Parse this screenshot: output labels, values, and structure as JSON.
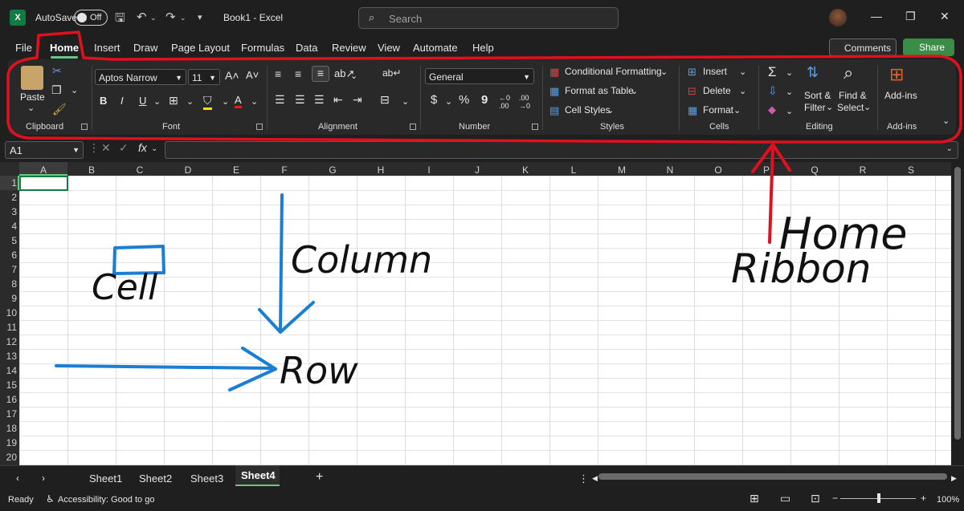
{
  "titlebar": {
    "autosave_label": "AutoSave",
    "autosave_state": "Off",
    "doc_title": "Book1  -  Excel",
    "search_placeholder": "Search"
  },
  "tabs": [
    "File",
    "Home",
    "Insert",
    "Draw",
    "Page Layout",
    "Formulas",
    "Data",
    "Review",
    "View",
    "Automate",
    "Help"
  ],
  "header_buttons": {
    "comments": "Comments",
    "share": "Share"
  },
  "ribbon": {
    "clipboard": {
      "paste": "Paste",
      "group": "Clipboard"
    },
    "font": {
      "family": "Aptos Narrow",
      "size": "11",
      "group": "Font",
      "bold": "B",
      "italic": "I",
      "underline": "U"
    },
    "alignment": {
      "group": "Alignment"
    },
    "number": {
      "format": "General",
      "group": "Number",
      "dollar": "$",
      "percent": "%",
      "comma": "9"
    },
    "styles": {
      "conditional_formatting": "Conditional Formatting",
      "format_as_table": "Format as Table",
      "cell_styles": "Cell Styles",
      "group": "Styles"
    },
    "cells": {
      "insert": "Insert",
      "delete": "Delete",
      "format": "Format",
      "group": "Cells"
    },
    "editing": {
      "sort_filter_1": "Sort &",
      "sort_filter_2": "Filter",
      "find_select_1": "Find &",
      "find_select_2": "Select",
      "group": "Editing"
    },
    "addins": {
      "label": "Add-ins",
      "group": "Add-ins"
    }
  },
  "formula_bar": {
    "name_box": "A1",
    "fx": "fx"
  },
  "grid": {
    "columns": [
      "A",
      "B",
      "C",
      "D",
      "E",
      "F",
      "G",
      "H",
      "I",
      "J",
      "K",
      "L",
      "M",
      "N",
      "O",
      "P",
      "Q",
      "R",
      "S"
    ],
    "rows": [
      "1",
      "2",
      "3",
      "4",
      "5",
      "6",
      "7",
      "8",
      "9",
      "10",
      "11",
      "12",
      "13",
      "14",
      "15",
      "16",
      "17",
      "18",
      "19",
      "20"
    ]
  },
  "sheets": [
    "Sheet1",
    "Sheet2",
    "Sheet3",
    "Sheet4"
  ],
  "active_sheet": "Sheet4",
  "status": {
    "ready": "Ready",
    "accessibility": "Accessibility: Good to go",
    "zoom": "100%"
  },
  "annotations": {
    "cell": "Cell",
    "column": "Column",
    "row": "Row",
    "home": "Home",
    "ribbon": "Ribbon"
  },
  "colors": {
    "accent_green": "#6cc785",
    "excel_green": "#107c41",
    "annotation_red": "#e0101e",
    "annotation_blue": "#1a7fd4"
  }
}
